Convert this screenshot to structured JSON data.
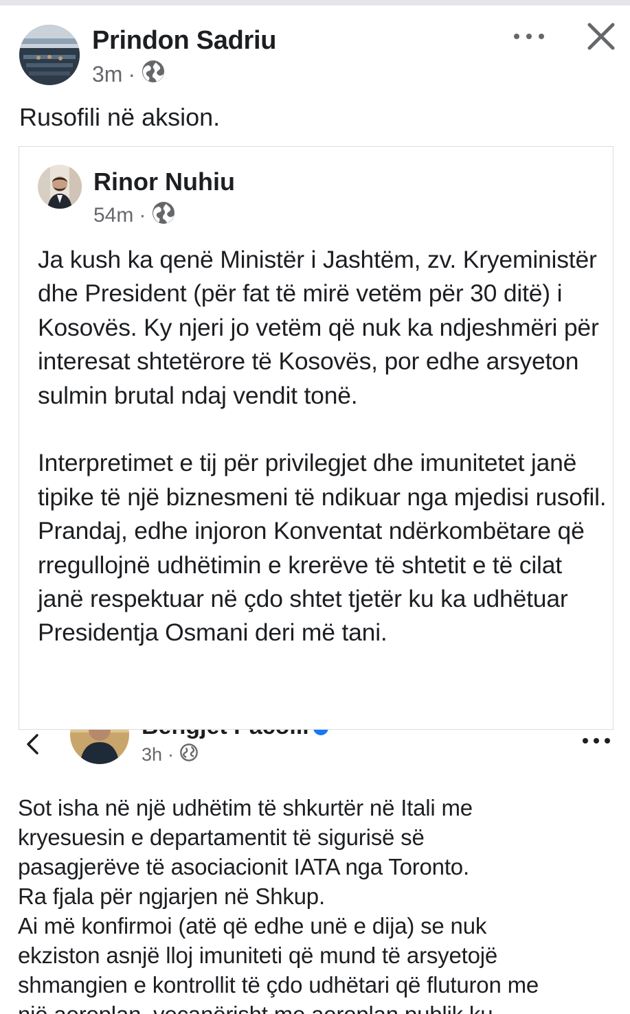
{
  "main_post": {
    "author": "Prindon Sadriu",
    "time": "3m",
    "separator": "·",
    "caption": "Rusofili në aksion.",
    "more_icon": "more-horizontal-icon",
    "close_icon": "close-icon"
  },
  "shared_post": {
    "author": "Rinor Nuhiu",
    "time": "54m",
    "separator": "·",
    "paragraphs": [
      "Ja kush ka qenë Ministër i Jashtëm, zv. Kryeministër dhe President (për fat të mirë vetëm për 30 ditë) i Kosovës. Ky njeri jo vetëm që nuk ka ndjeshmëri për interesat shtetërore të Kosovës, por edhe arsyeton sulmin brutal ndaj vendit tonë.",
      "Interpretimet e tij për privilegjet dhe imunitetet janë tipike të një biznesmeni të ndikuar nga mjedisi rusofil. Prandaj, edhe injoron Konventat ndërkombëtare që rregullojnë udhëtimin e krerëve të shtetit e të cilat janë respektuar në çdo shtet tjetër ku ka udhëtuar Presidentja Osmani deri më tani."
    ]
  },
  "embedded_screenshot": {
    "author": "Bengjet Pacolli",
    "time": "3h",
    "separator": "·",
    "lines": [
      "Sot isha në një udhëtim të shkurtër në Itali me",
      "kryesuesin e departamentit të sigurisë së",
      "pasagjerëve të asociacionit IATA nga Toronto.",
      "Ra fjala për ngjarjen në Shkup.",
      "Ai më konfirmoi (atë që edhe unë e dija) se nuk",
      "ekziston asnjë lloj imuniteti që mund të arsyetojë",
      "shmangien e kontrollit të çdo udhëtari që fluturon me",
      "një aeroplan, veçanërisht me aeroplan publik ku"
    ]
  },
  "colors": {
    "text": "#1c1e21",
    "meta": "#65676b",
    "border": "#dadde1",
    "verified": "#1877f2"
  }
}
